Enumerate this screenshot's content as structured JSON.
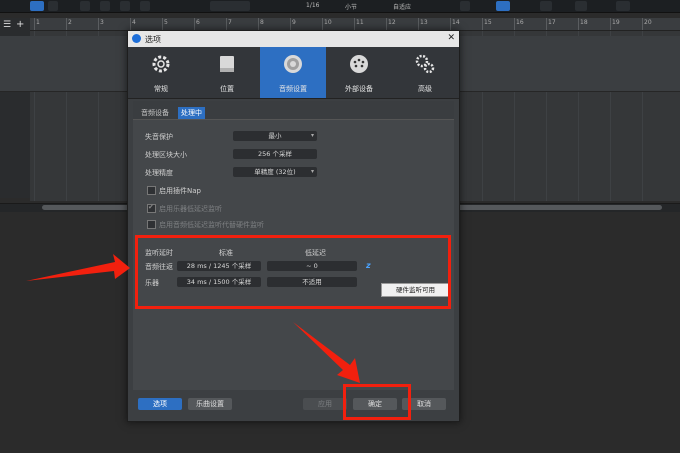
{
  "toolbar": {
    "time_signature": "1/16",
    "snap_unit": "小节",
    "snap_mode": "自适应"
  },
  "ruler": {
    "ticks": [
      "1",
      "2",
      "3",
      "4",
      "5",
      "6",
      "7",
      "8",
      "9",
      "10",
      "11",
      "12",
      "13",
      "14",
      "15",
      "16",
      "17",
      "18",
      "19",
      "20"
    ]
  },
  "dialog": {
    "title": "选项",
    "close_glyph": "✕",
    "nav": [
      {
        "label": "常规",
        "icon": "gear-cog-icon"
      },
      {
        "label": "位置",
        "icon": "disk-drive-icon"
      },
      {
        "label": "音频设置",
        "icon": "speaker-icon"
      },
      {
        "label": "外部设备",
        "icon": "midi-port-icon"
      },
      {
        "label": "高级",
        "icon": "gears-icon"
      }
    ],
    "subtabs": [
      "音频设备",
      "处理中"
    ],
    "settings": {
      "dropout_protection_label": "失音保护",
      "dropout_protection_value": "最小",
      "block_size_label": "处理区块大小",
      "block_size_value": "256 个采样",
      "precision_label": "处理精度",
      "precision_value": "单精度 (32位)",
      "enable_nap_label": "启用插件Nap",
      "low_latency_monitor_label": "启用乐器低延迟监听",
      "hardware_monitor_label": "启用音频低延迟监听代替硬件监听"
    },
    "latency": {
      "header_monitor": "监听延时",
      "header_standard": "标准",
      "header_low": "低延迟",
      "rows": [
        {
          "label": "音频往返",
          "standard": "28 ms / 1245 个采样",
          "low": "~ 0",
          "icon": "z-link-icon"
        },
        {
          "label": "乐器",
          "standard": "34 ms / 1500 个采样",
          "low": "不适用"
        }
      ],
      "tooltip": "硬件监听可用"
    },
    "buttons": {
      "options": "选项",
      "song_settings": "乐曲设置",
      "apply": "应用",
      "ok": "确定",
      "cancel": "取消"
    }
  },
  "colors": {
    "accent": "#2d6fc2",
    "annotation_red": "#f2200e"
  }
}
